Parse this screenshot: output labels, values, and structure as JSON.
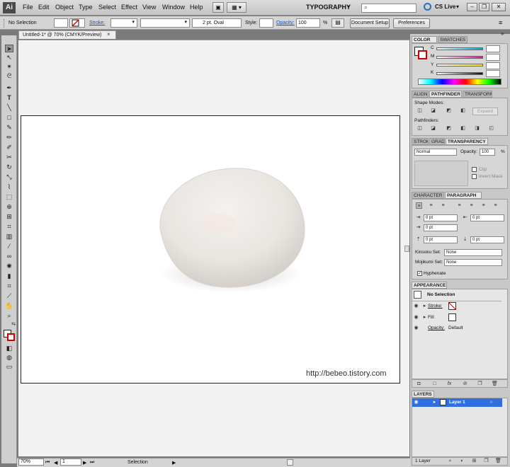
{
  "app": {
    "logo": "Ai",
    "menus": [
      "File",
      "Edit",
      "Object",
      "Type",
      "Select",
      "Effect",
      "View",
      "Window",
      "Help"
    ],
    "workspace": "TYPOGRAPHY",
    "search_placeholder": "",
    "cs_live": "CS Live"
  },
  "control_bar": {
    "selection": "No Selection",
    "stroke_label": "Stroke:",
    "brush": "2 pt. Oval",
    "style_label": "Style:",
    "opacity_label": "Opacity:",
    "opacity_value": "100",
    "opacity_unit": "%",
    "doc_setup": "Document Setup",
    "preferences": "Preferences"
  },
  "document": {
    "tab_title": "Untitled-1* @ 70% (CMYK/Preview)",
    "close_glyph": "×",
    "url": "http://bebeo.tistory.com"
  },
  "status_bar": {
    "zoom": "70%",
    "page": "1",
    "tool": "Selection"
  },
  "color_panel": {
    "tabs": [
      "COLOR",
      "SWATCHES"
    ],
    "channels": [
      "C",
      "M",
      "Y",
      "K"
    ],
    "channel_colors": [
      "#00a8d8",
      "#d8188a",
      "#f0e800",
      "#101010"
    ]
  },
  "pathfinder_panel": {
    "tabs": [
      "ALIGN",
      "PATHFINDER",
      "TRANSFORM"
    ],
    "shape_modes": "Shape Modes:",
    "pathfinders": "Pathfinders:",
    "expand": "Expand"
  },
  "transparency_panel": {
    "tabs": [
      "STROKE",
      "GRADIENT",
      "TRANSPARENCY"
    ],
    "blend": "Normal",
    "opacity_label": "Opacity:",
    "opacity_value": "100",
    "unit": "%",
    "clip": "Clip",
    "invert_mask": "Invert Mask"
  },
  "paragraph_panel": {
    "tabs": [
      "CHARACTER",
      "PARAGRAPH"
    ],
    "fields": [
      "0 pt",
      "0 pt",
      "0 pt",
      "0 pt",
      "0 pt"
    ],
    "kinsoku_label": "Kinsoku Set:",
    "kinsoku_value": "None",
    "mojikumi_label": "Mojikumi Set:",
    "mojikumi_value": "None",
    "hyphenate": "Hyphenate"
  },
  "appearance_panel": {
    "tab": "APPEARANCE",
    "title": "No Selection",
    "stroke": "Stroke:",
    "fill": "Fill:",
    "opacity": "Opacity:",
    "opacity_value": "Default"
  },
  "layers_panel": {
    "tab": "LAYERS",
    "layer_name": "Layer 1",
    "count": "1 Layer",
    "layer_color": "#2f6fe0"
  }
}
